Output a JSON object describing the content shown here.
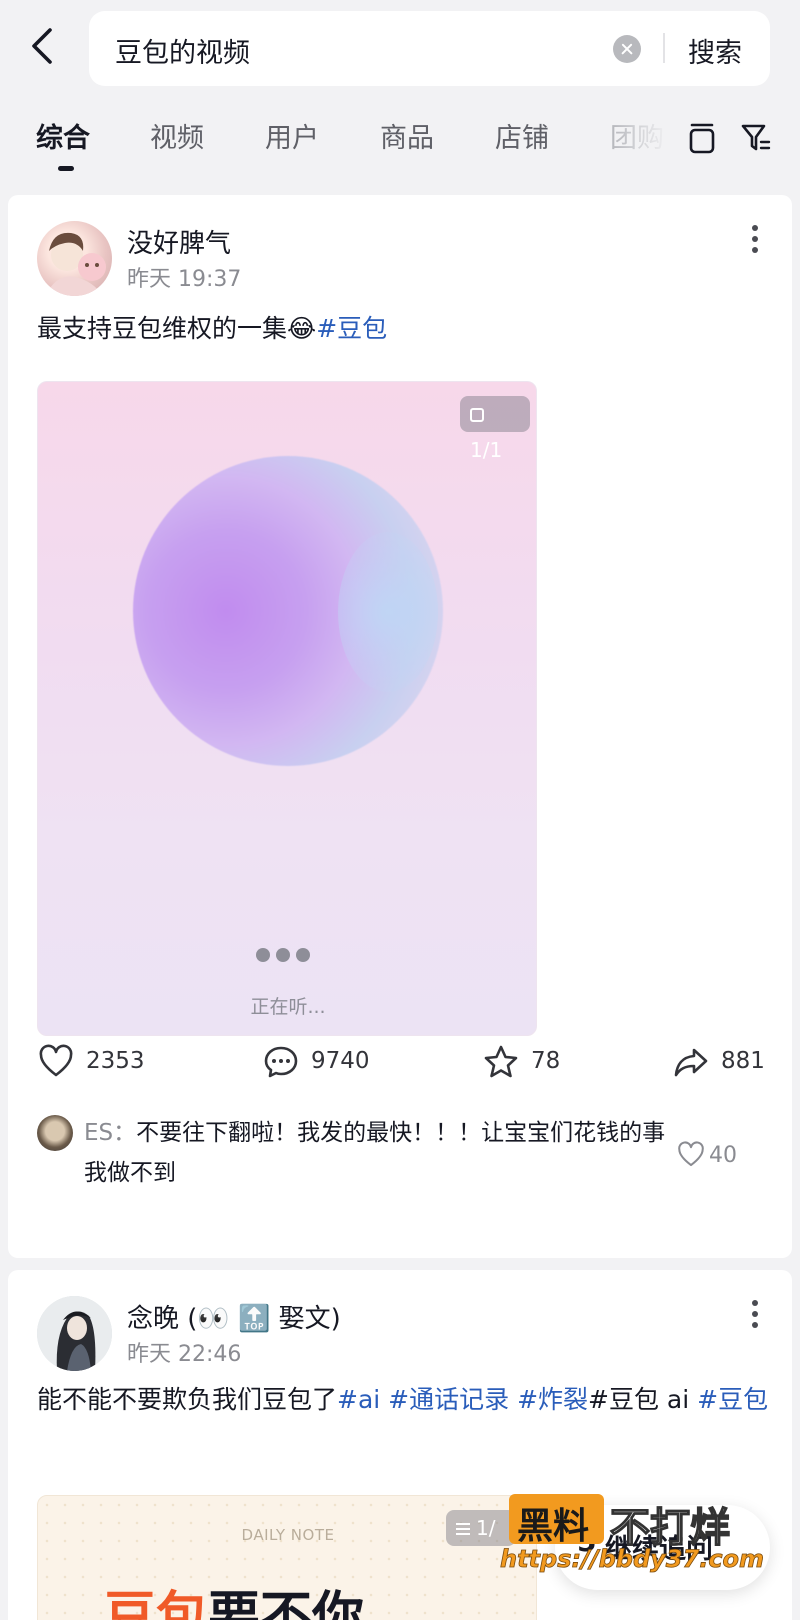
{
  "search": {
    "query": "豆包的视频",
    "submit_label": "搜索"
  },
  "tabs": [
    {
      "label": "综合",
      "active": true
    },
    {
      "label": "视频"
    },
    {
      "label": "用户"
    },
    {
      "label": "商品"
    },
    {
      "label": "店铺"
    },
    {
      "label": "团购"
    }
  ],
  "posts": [
    {
      "username": "没好脾气",
      "time": "昨天 19:37",
      "caption_text": "最支持豆包维权的一集😂",
      "caption_tags": "#豆包",
      "media": {
        "badge": "1/1",
        "status_text": "正在听..."
      },
      "stats": {
        "likes": "2353",
        "comments": "9740",
        "favorites": "78",
        "shares": "881"
      },
      "top_comment": {
        "user": "ES：",
        "text": "不要往下翻啦！我发的最快！！！让宝宝们花钱的事我做不到",
        "likes": "40"
      }
    },
    {
      "username": "念晚 (👀 🔝 娶文)",
      "time": "昨天 22:46",
      "caption_plain_1": "能不能不要欺负我们豆包了",
      "caption_tags_1": "#ai #通话记录 #炸裂",
      "caption_plain_2": "#豆包 ai ",
      "caption_tags_2": "#豆包",
      "media": {
        "badge": "1/",
        "header_text": "DAILY NOTE",
        "title_accent": "豆包",
        "title_rest": "要不你"
      }
    }
  ],
  "floating_button": {
    "number": "5",
    "label": "继续追问"
  },
  "watermark": {
    "brand_1": "黑料",
    "brand_2": "不打烊",
    "url": "https://bbdy37.com"
  },
  "colors": {
    "tag_blue": "#2a5dba",
    "accent_orange": "#f05a28",
    "watermark_orange": "#f29a1f"
  }
}
